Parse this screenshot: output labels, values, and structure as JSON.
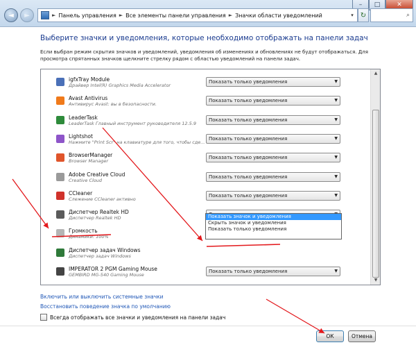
{
  "window": {
    "controls": {
      "minimize": "–",
      "maximize": "□",
      "close": "✕"
    }
  },
  "address_bar": {
    "crumbs": [
      "Панель управления",
      "Все элементы панели управления",
      "Значки области уведомлений"
    ],
    "separator": "►",
    "dropdown": "▾",
    "search_icon": "⌕",
    "refresh_icon": "↻"
  },
  "nav": {
    "back": "◄",
    "forward": "►",
    "history": "▾"
  },
  "heading": "Выберите значки и уведомления, которые необходимо отображать на панели задач",
  "description": "Если выбран режим скрытия значков и уведомлений, уведомления об изменениях и обновлениях не будут отображаться. Для просмотра спрятанных значков щелкните стрелку рядом с областью уведомлений на панели задач.",
  "items": [
    {
      "name": "igfxTray Module",
      "sub": "Драйвер Intel(R) Graphics Media Accelerator",
      "behavior": "Показать только уведомления",
      "icon": "intel-icon",
      "icon_color": "#4a70b8"
    },
    {
      "name": "Avast Antivirus",
      "sub": "Антивирус Avast: вы в безопасности.",
      "behavior": "Показать только уведомления",
      "icon": "avast-icon",
      "icon_color": "#f07a1b"
    },
    {
      "name": "LeaderTask",
      "sub": "LeaderTask Главный инструмент руководителя 12.5.9",
      "behavior": "Показать только уведомления",
      "icon": "leadertask-icon",
      "icon_color": "#2e8b3b"
    },
    {
      "name": "Lightshot",
      "sub": "Нажмите \"Print Scr\" на клавиатуре для того, чтобы сде...",
      "behavior": "Показать только уведомления",
      "icon": "lightshot-icon",
      "icon_color": "#8e55c9"
    },
    {
      "name": "BrowserManager",
      "sub": "Browser Manager",
      "behavior": "Показать только уведомления",
      "icon": "browsermanager-icon",
      "icon_color": "#e0552b"
    },
    {
      "name": "Adobe Creative Cloud",
      "sub": "Creative Cloud",
      "behavior": "Показать только уведомления",
      "icon": "creative-cloud-icon",
      "icon_color": "#9a9a9a"
    },
    {
      "name": "CCleaner",
      "sub": "Слежение CCleaner активно",
      "behavior": "Показать только уведомления",
      "icon": "ccleaner-icon",
      "icon_color": "#d0322b"
    },
    {
      "name": "Диспетчер Realtek HD",
      "sub": "Диспетчер Realtek HD",
      "behavior": "Скрыть значок и уведомления",
      "icon": "speaker-icon",
      "icon_color": "#5b5b5b"
    },
    {
      "name": "Громкость",
      "sub": "Динамики: 100%",
      "behavior": "Скрыть значок и уведомления",
      "icon": "volume-icon",
      "icon_color": "#b5b5b5"
    },
    {
      "name": "Диспетчер задач Windows",
      "sub": "Диспетчер задач Windows",
      "behavior": "",
      "icon": "task-manager-icon",
      "icon_color": "#2f7a3a"
    },
    {
      "name": "IMPERATOR 2 PGM Gaming Mouse",
      "sub": "GEMBIRD MG-540 Gaming Mouse",
      "behavior": "Показать только уведомления",
      "icon": "mouse-icon",
      "icon_color": "#444444"
    }
  ],
  "dropdown_options": [
    "Показать значок и уведомления",
    "Скрыть значок и уведомления",
    "Показать только уведомления"
  ],
  "dropdown_highlighted": 0,
  "links": {
    "system_icons": "Включить или выключить системные значки",
    "restore_defaults": "Восстановить поведение значка по умолчанию"
  },
  "always_show": {
    "label": "Всегда отображать все значки и уведомления на панели задач",
    "checked": false
  },
  "buttons": {
    "ok": "ОК",
    "cancel": "Отмена"
  },
  "scroll": {
    "up": "▲",
    "down": "▼"
  },
  "colors": {
    "heading": "#1a3b8f",
    "link": "#1e56b6",
    "annotation": "#e3181c",
    "highlight": "#3399ff"
  }
}
